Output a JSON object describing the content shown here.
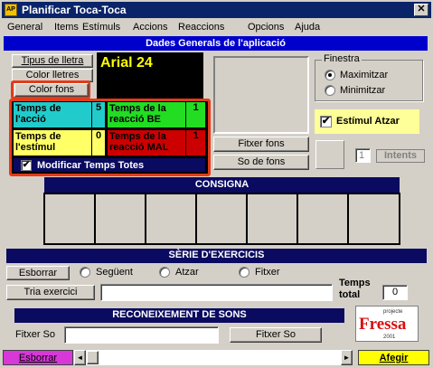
{
  "window": {
    "title": "Planificar Toca-Toca",
    "icon_text": "AP",
    "close_glyph": "✕"
  },
  "menu": [
    "General",
    "Items",
    "Estímuls",
    "Accions",
    "Reaccions",
    "Opcions",
    "Ajuda"
  ],
  "header": {
    "title": "Dades Generals de l'aplicació"
  },
  "font_buttons": {
    "tipus": "Tipus de lletra",
    "color_lletres": "Color lletres",
    "color_fons": "Color fons"
  },
  "font_preview": "Arial 24",
  "finestra": {
    "title": "Finestra",
    "maximitzar": "Maximitzar",
    "minimitzar": "Minimitzar",
    "selected": "Maximitzar"
  },
  "estimul_atzar": {
    "label": "Estímul Atzar",
    "checked": true,
    "check_glyph": "✔"
  },
  "times": {
    "accio_label": "Temps de l'acció",
    "accio_value": "5",
    "reaccio_be_label": "Temps de la reacció BE",
    "reaccio_be_value": "1",
    "estimul_label": "Temps de l'estímul",
    "estimul_value": "0",
    "reaccio_mal_label": "Temps de la reacció MAL",
    "reaccio_mal_value": "1",
    "modificar_label": "Modificar Temps Totes"
  },
  "fons_buttons": {
    "fixar": "Fitxer fons",
    "so": "So de fons"
  },
  "intents": {
    "value": "1",
    "label": "Intents"
  },
  "consigna": {
    "title": "CONSIGNA"
  },
  "serie": {
    "title": "SÈRIE D'EXERCICIS",
    "esborrar": "Esborrar",
    "seguent": "Següent",
    "atzar": "Atzar",
    "fitxer": "Fitxer",
    "tria": "Tria exercici",
    "exercici_value": "",
    "temps_total_label": "Temps total",
    "temps_total_value": "0"
  },
  "sons": {
    "title": "RECONEIXEMENT DE SONS",
    "fitxer_label": "Fitxer So",
    "fitxer_value": "",
    "button": "Fitxer So"
  },
  "logo": {
    "small": "projecte",
    "name": "Fressa",
    "year": "2001"
  },
  "bottom": {
    "esborrar": "Esborrar",
    "afegir": "Afegir",
    "left_arrow": "◄",
    "right_arrow": "►"
  }
}
